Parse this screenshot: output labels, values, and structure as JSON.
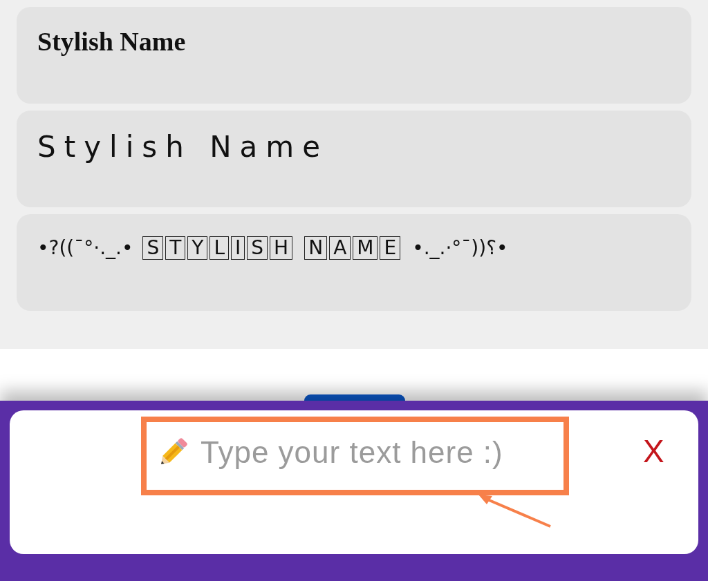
{
  "name_styles": [
    {
      "kind": "serif-bold",
      "text": "Stylish Name"
    },
    {
      "kind": "spaced",
      "text": "Stylish Name"
    },
    {
      "kind": "boxed",
      "parts": [
        {
          "kind": "text",
          "text": "•?((¯°·._.•"
        },
        {
          "kind": "tiles",
          "letters": [
            "S",
            "T",
            "Y",
            "L",
            "I",
            "S",
            "H"
          ]
        },
        {
          "kind": "tiles",
          "letters": [
            "N",
            "A",
            "M",
            "E"
          ]
        },
        {
          "kind": "text",
          "text": "•._.·°¯))؟•"
        }
      ]
    }
  ],
  "input_bar": {
    "placeholder": "Type your text here :)",
    "close_label": "X"
  }
}
